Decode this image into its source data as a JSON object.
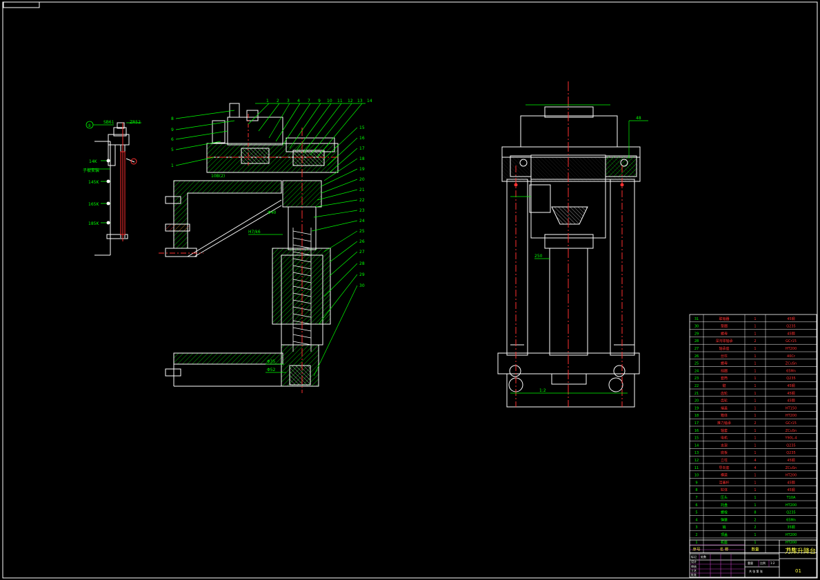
{
  "colors": {
    "background": "#000000",
    "frame": "#ffffff",
    "outline": "#ffffff",
    "dimension": "#00ff00",
    "centerline": "#ff2020",
    "table_text_green": "#00ff00",
    "table_text_red": "#ff3030",
    "title_purple": "#c040c0",
    "title_yellow": "#ffff40"
  },
  "left_view": {
    "label_circle": "①",
    "label_top1": "SB61",
    "label_top2": "ZR52",
    "label_14": "14K",
    "label_plate": "子板安装",
    "label_145": "145K",
    "label_165": "165K",
    "label_185": "185K"
  },
  "middle_view": {
    "left_callouts": [
      "8",
      "9",
      "6",
      "5",
      "1"
    ],
    "top_callouts": [
      "1",
      "2",
      "3",
      "4",
      "7",
      "9",
      "10",
      "11",
      "12",
      "13",
      "14"
    ],
    "right_callouts": [
      "15",
      "16",
      "17",
      "18",
      "19",
      "20",
      "21",
      "22",
      "23",
      "24",
      "25",
      "26",
      "27",
      "28",
      "29",
      "30"
    ],
    "note_1": "10B(2)",
    "note_2": "H7/k6",
    "note_3": "Φ40",
    "note_4": "Φ35",
    "note_5": "Φ52"
  },
  "right_view": {
    "label_top": "48",
    "label_side": "250",
    "label_bottom": "1:2"
  },
  "bom": {
    "rows": [
      [
        "31",
        "联轴器",
        "1",
        "45钢"
      ],
      [
        "30",
        "垫圈",
        "1",
        "Q235"
      ],
      [
        "29",
        "螺母",
        "1",
        "45钢"
      ],
      [
        "28",
        "深沟球轴承",
        "2",
        "GCr15"
      ],
      [
        "27",
        "轴承座",
        "1",
        "HT200"
      ],
      [
        "26",
        "丝杠",
        "1",
        "40Cr"
      ],
      [
        "25",
        "螺母",
        "1",
        "ZCuSn"
      ],
      [
        "24",
        "挡圈",
        "1",
        "65Mn"
      ],
      [
        "23",
        "套筒",
        "1",
        "Q235"
      ],
      [
        "22",
        "键",
        "1",
        "45钢"
      ],
      [
        "21",
        "齿轮",
        "1",
        "45钢"
      ],
      [
        "20",
        "齿轮",
        "1",
        "45钢"
      ],
      [
        "19",
        "端盖",
        "1",
        "HT150"
      ],
      [
        "18",
        "箱体",
        "1",
        "HT200"
      ],
      [
        "17",
        "推力轴承",
        "2",
        "GCr15"
      ],
      [
        "16",
        "轴套",
        "1",
        "ZCuSn"
      ],
      [
        "15",
        "电机",
        "1",
        "Y90L-4"
      ],
      [
        "14",
        "支架",
        "1",
        "Q235"
      ],
      [
        "13",
        "底板",
        "1",
        "Q235"
      ],
      [
        "12",
        "立柱",
        "4",
        "45钢"
      ],
      [
        "11",
        "导向套",
        "4",
        "ZCuSn"
      ],
      [
        "10",
        "横梁",
        "1",
        "HT200"
      ],
      [
        "9",
        "活塞杆",
        "1",
        "45钢"
      ],
      [
        "8",
        "缸体",
        "1",
        "45钢"
      ],
      [
        "7",
        "压头",
        "1",
        "T10A"
      ],
      [
        "6",
        "托盘",
        "1",
        "HT200"
      ],
      [
        "5",
        "螺栓",
        "8",
        "Q235"
      ],
      [
        "4",
        "弹簧",
        "2",
        "65Mn"
      ],
      [
        "3",
        "销",
        "2",
        "35钢"
      ],
      [
        "2",
        "顶盖",
        "1",
        "HT200"
      ],
      [
        "1",
        "机座",
        "1",
        "HT200"
      ]
    ],
    "header": [
      "序号",
      "名 称",
      "数量",
      "材 料"
    ]
  },
  "title_block": {
    "drawing_title": "刀库升降台",
    "drawing_number": "01",
    "scale_label": "比例",
    "scale_value": "1:2",
    "sheet_label": "共 张 第 张",
    "design": "设计",
    "check": "审核",
    "approve": "批准",
    "process": "工艺",
    "mark": "标记",
    "count": "处数",
    "weight": "重量"
  }
}
